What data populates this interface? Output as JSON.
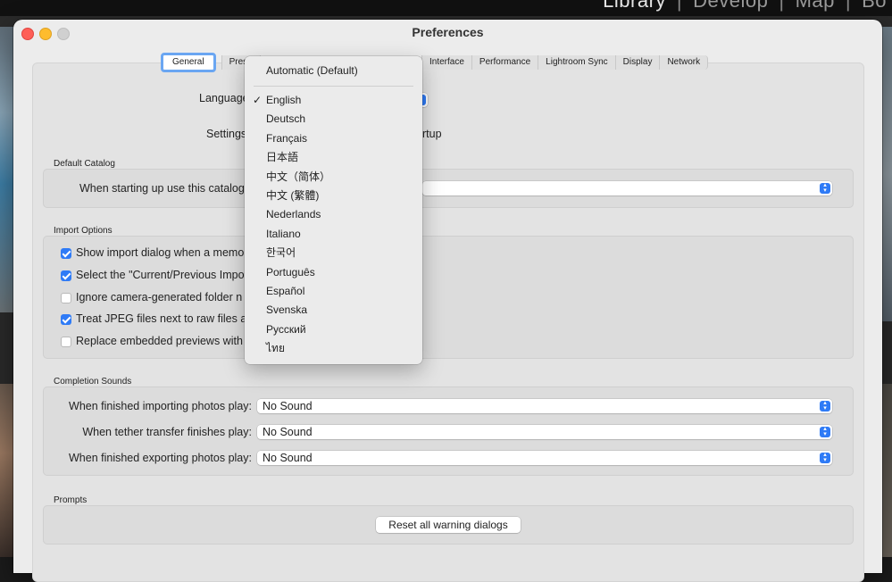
{
  "lightroom": {
    "modules": [
      "Library",
      "Develop",
      "Map",
      "Bo"
    ]
  },
  "window": {
    "title": "Preferences"
  },
  "tabs": [
    "General",
    "Prese",
    "Interface",
    "Performance",
    "Lightroom Sync",
    "Display",
    "Network"
  ],
  "general": {
    "language_label": "Language",
    "settings_label": "Settings",
    "settings_partial_value": "rtup"
  },
  "default_catalog": {
    "title": "Default Catalog",
    "label": "When starting up use this catalog"
  },
  "import_options": {
    "title": "Import Options",
    "items": [
      {
        "label": "Show import dialog when a memo",
        "checked": true
      },
      {
        "label": "Select the \"Current/Previous Impo",
        "checked": true
      },
      {
        "label": "Ignore camera-generated folder n",
        "checked": false
      },
      {
        "label": "Treat JPEG files next to raw files a",
        "checked": true
      },
      {
        "label": "Replace embedded previews with",
        "checked": false
      }
    ]
  },
  "completion_sounds": {
    "title": "Completion Sounds",
    "rows": [
      {
        "label": "When finished importing photos play:",
        "value": "No Sound"
      },
      {
        "label": "When tether transfer finishes play:",
        "value": "No Sound"
      },
      {
        "label": "When finished exporting photos play:",
        "value": "No Sound"
      }
    ]
  },
  "prompts": {
    "title": "Prompts",
    "reset_button": "Reset all warning dialogs"
  },
  "language_menu": {
    "automatic": "Automatic (Default)",
    "selected": "English",
    "items": [
      "English",
      "Deutsch",
      "Français",
      "日本語",
      "中文（简体）",
      "中文 (繁體)",
      "Nederlands",
      "Italiano",
      "한국어",
      "Português",
      "Español",
      "Svenska",
      "Русский",
      "ไทย"
    ]
  },
  "colors": {
    "accent": "#2f7bf6",
    "tab_focus": "#6aa6f2"
  }
}
